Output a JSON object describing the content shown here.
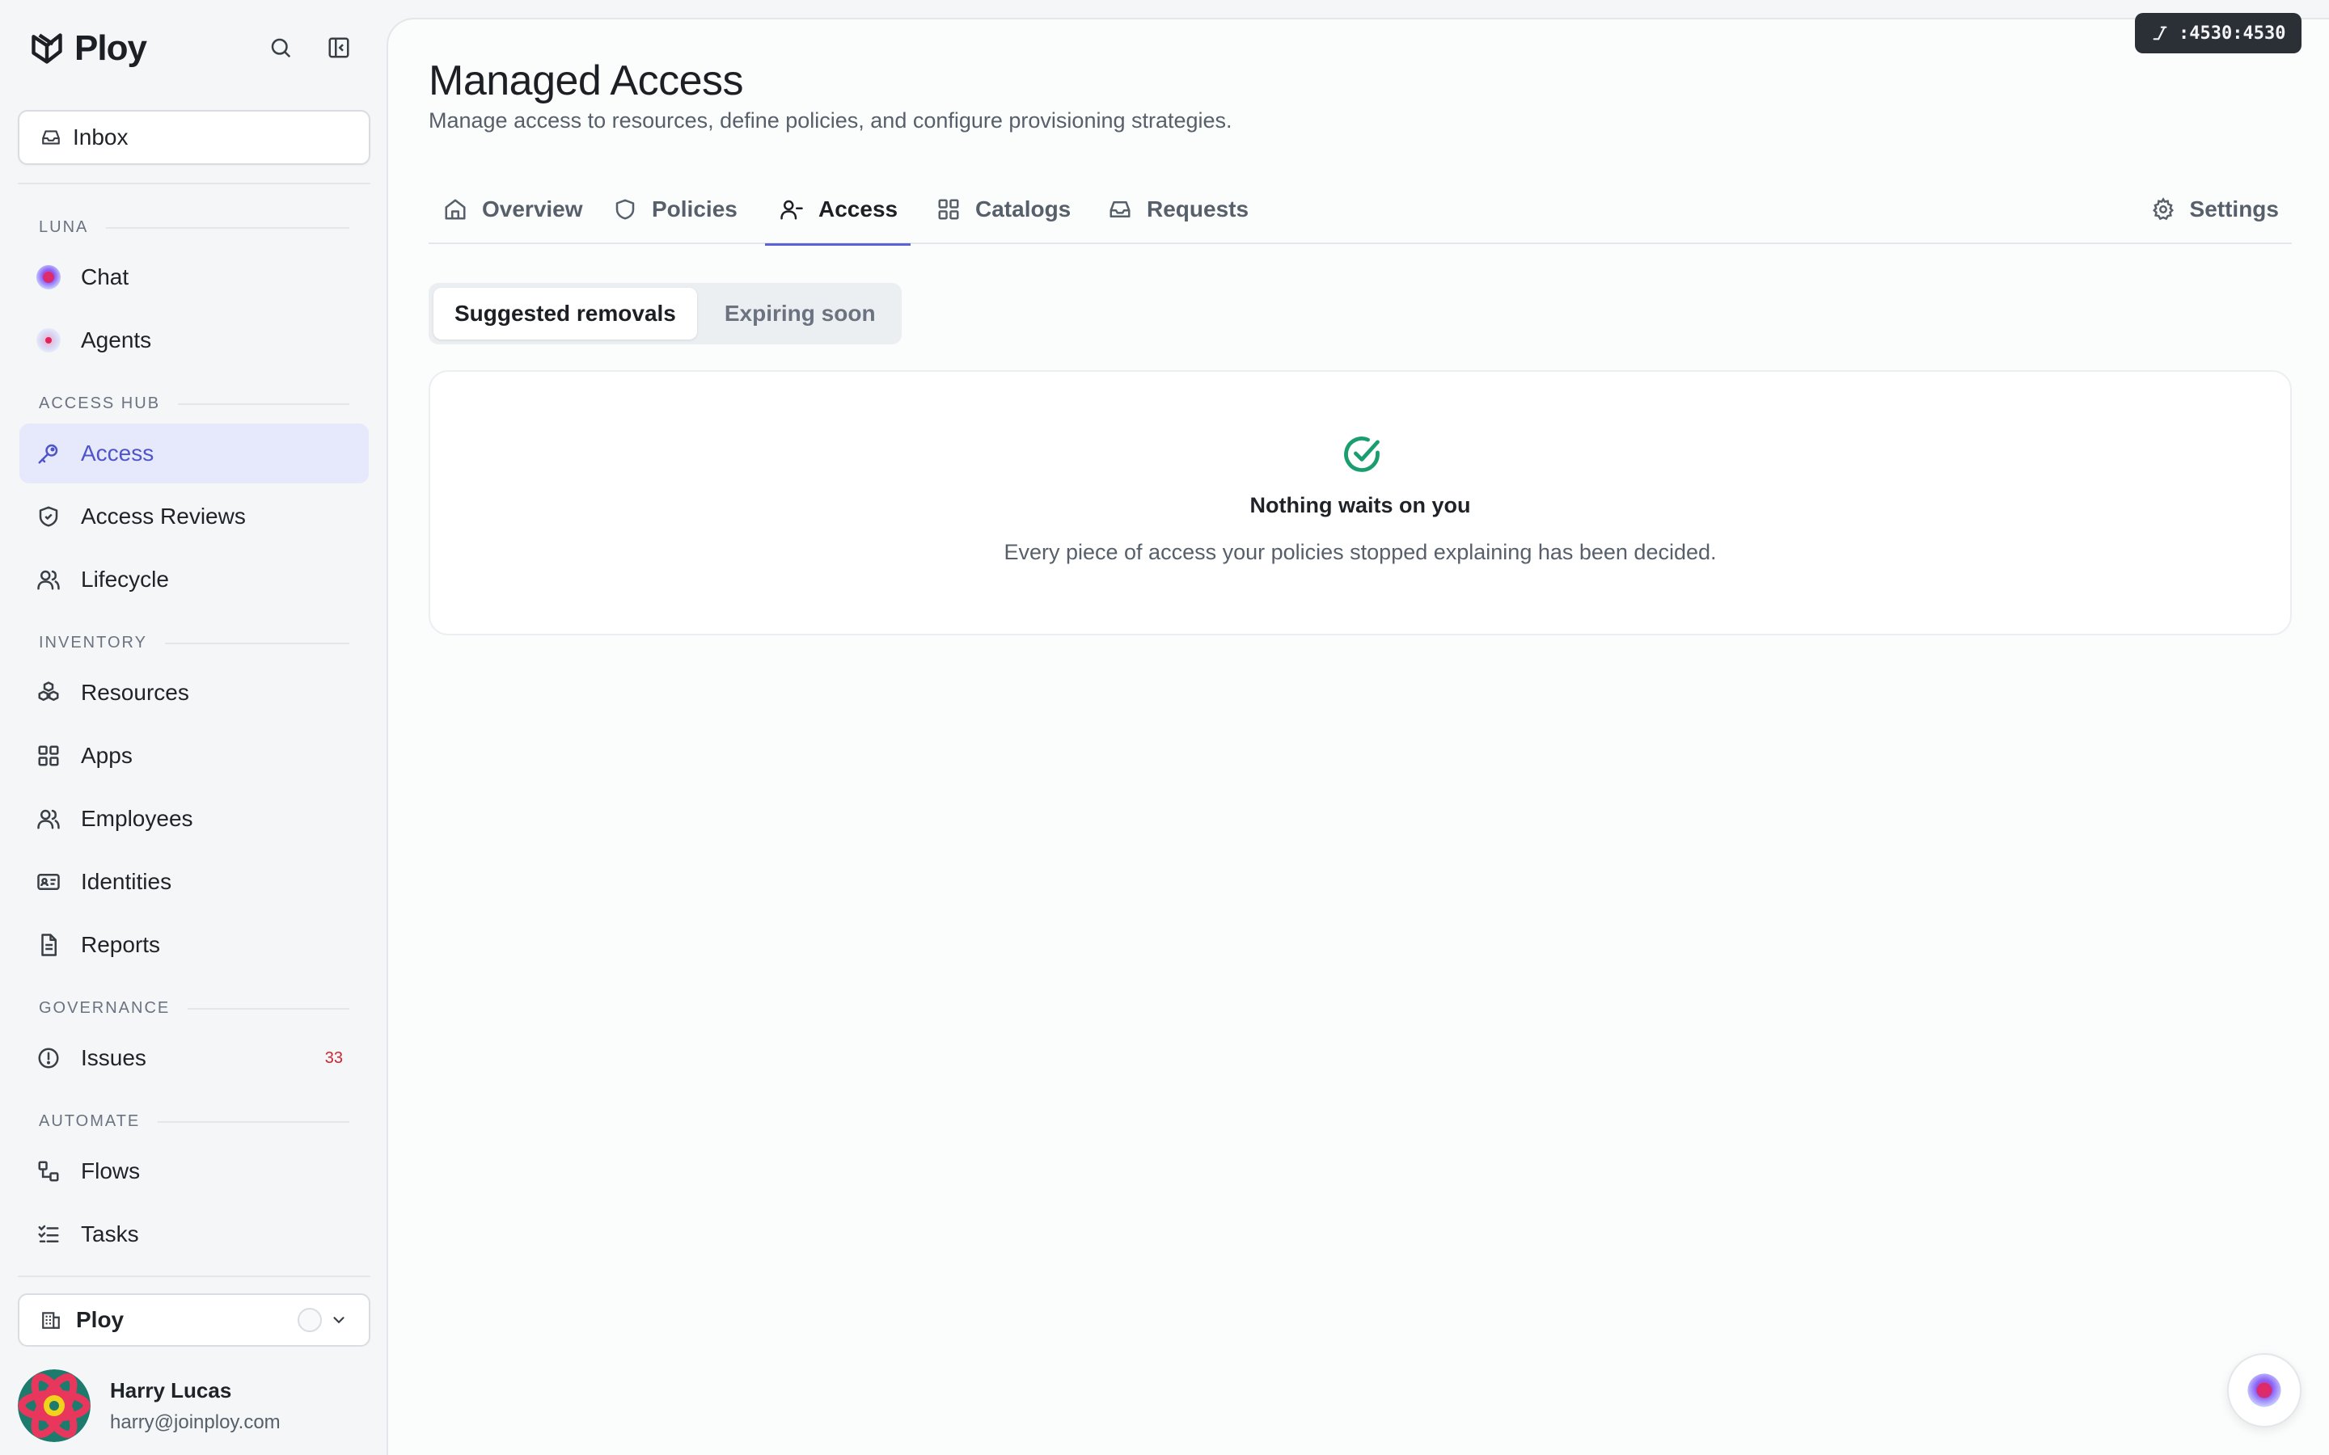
{
  "brand": {
    "name": "Ploy"
  },
  "sidebar": {
    "inbox_label": "Inbox",
    "sections": {
      "luna": "LUNA",
      "access_hub": "ACCESS HUB",
      "inventory": "INVENTORY",
      "governance": "GOVERNANCE",
      "automate": "AUTOMATE"
    },
    "items": {
      "chat": "Chat",
      "agents": "Agents",
      "access": "Access",
      "access_reviews": "Access Reviews",
      "lifecycle": "Lifecycle",
      "resources": "Resources",
      "apps": "Apps",
      "employees": "Employees",
      "identities": "Identities",
      "reports": "Reports",
      "issues": "Issues",
      "issues_badge": "33",
      "flows": "Flows",
      "tasks": "Tasks"
    },
    "org_select": "Ploy",
    "user": {
      "name": "Harry Lucas",
      "email": "harry@joinploy.com"
    }
  },
  "main": {
    "title": "Managed Access",
    "subtitle": "Manage access to resources, define policies, and configure provisioning strategies.",
    "tabs": {
      "overview": "Overview",
      "policies": "Policies",
      "access": "Access",
      "catalogs": "Catalogs",
      "requests": "Requests",
      "settings": "Settings"
    },
    "segments": {
      "suggested": "Suggested removals",
      "expiring": "Expiring soon"
    },
    "empty": {
      "title": "Nothing waits on you",
      "description": "Every piece of access your policies stopped explaining has been decided."
    }
  },
  "dev_badge": ":4530:4530",
  "colors": {
    "accent": "#5b61d6",
    "active_bg": "#e6e8fb",
    "success": "#1a9e6f",
    "danger": "#d1242f"
  }
}
